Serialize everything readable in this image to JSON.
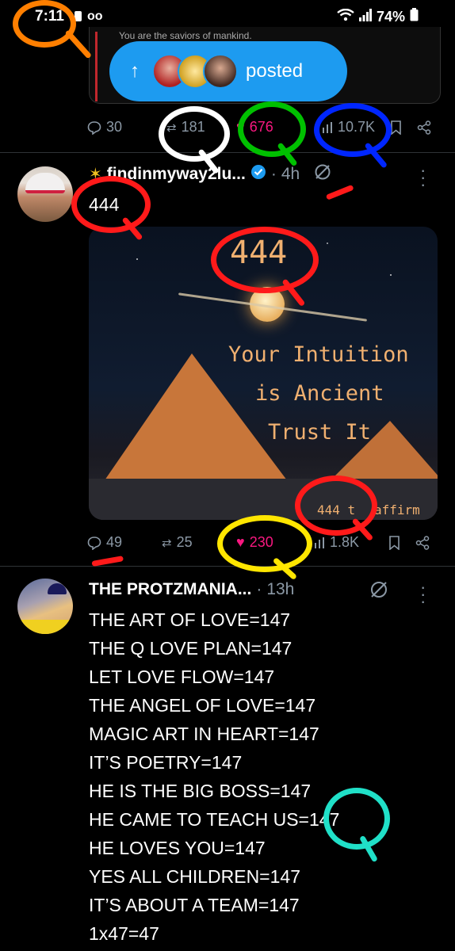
{
  "status_bar": {
    "time": "7:11",
    "battery": "74%"
  },
  "previous_post": {
    "text": "You are the saviors of mankind.",
    "posted_pill_label": "posted",
    "arrow": "↑",
    "actions": {
      "replies": "30",
      "reposts": "181",
      "likes": "676",
      "views": "10.7K"
    }
  },
  "post1": {
    "display_name": "findinmyway2lu...",
    "time": "4h",
    "text": "444",
    "media": {
      "big_number": "444",
      "line1": "Your Intuition",
      "line2": "is Ancient",
      "line3": "Trust It",
      "caption_left": "444 t",
      "caption_right": "affirm"
    },
    "actions": {
      "replies": "49",
      "reposts": "25",
      "likes": "230",
      "views": "1.8K"
    }
  },
  "post2": {
    "display_name": "THE PROTZMANIA...",
    "time": "13h",
    "lines": [
      "THE ART OF LOVE=147",
      "THE Q LOVE PLAN=147",
      "LET LOVE FLOW=147",
      "THE ANGEL OF LOVE=147",
      "MAGIC ART IN HEART=147",
      "IT’S POETRY=147",
      "HE IS THE BIG BOSS=147",
      "HE CAME TO TEACH US=147",
      "HE LOVES YOU=147",
      "YES ALL CHILDREN=147",
      "IT’S ABOUT A TEAM=147",
      "1x47=47"
    ]
  },
  "colors": {
    "accent": "#1d9bf0",
    "like": "#f91880",
    "muted": "#8b98a5",
    "marker_orange": "#ff7f00",
    "marker_white": "#ffffff",
    "marker_green": "#00c000",
    "marker_blue": "#0026ff",
    "marker_red": "#ff1a1a",
    "marker_yellow": "#ffe600",
    "marker_teal": "#20e0c8"
  }
}
